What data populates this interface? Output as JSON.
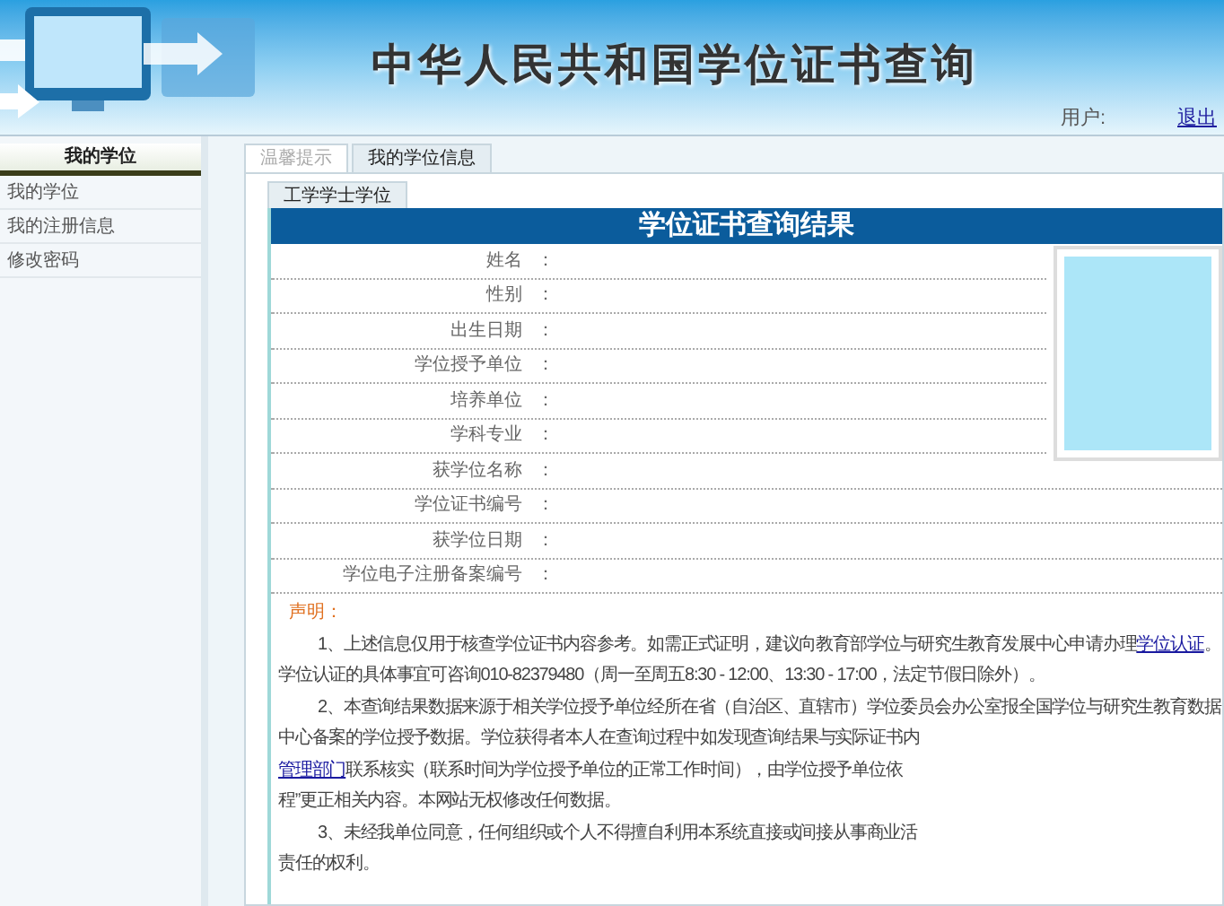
{
  "header": {
    "title": "中华人民共和国学位证书查询",
    "user_label": "用户:",
    "logout": "退出"
  },
  "sidebar": {
    "title": "我的学位",
    "items": [
      {
        "label": "我的学位"
      },
      {
        "label": "我的注册信息"
      },
      {
        "label": "修改密码"
      }
    ]
  },
  "tabs": [
    {
      "label": "温馨提示",
      "selected": false
    },
    {
      "label": "我的学位信息",
      "selected": true
    }
  ],
  "subtabs": [
    {
      "label": "工学学士学位",
      "selected": true
    }
  ],
  "result": {
    "title": "学位证书查询结果",
    "fields": [
      {
        "label": "姓名"
      },
      {
        "label": "性别"
      },
      {
        "label": "出生日期"
      },
      {
        "label": "学位授予单位"
      },
      {
        "label": "培养单位"
      },
      {
        "label": "学科专业"
      },
      {
        "label": "获学位名称"
      },
      {
        "label": "学位证书编号"
      },
      {
        "label": "获学位日期"
      },
      {
        "label": "学位电子注册备案编号"
      }
    ],
    "colon": "："
  },
  "notice": {
    "title": "声明：",
    "paragraphs": [
      {
        "lines": [
          [
            {
              "text": "1、上述信息仅用于核查学位证书内容参考。如需正式证明，建议向教育部学位与研究生教育发展中心申请办理"
            },
            {
              "text": "学位认证",
              "link": true
            },
            {
              "text": "。"
            }
          ],
          [
            {
              "text": "学位认证的具体事宜可咨询010-82379480（周一至周五8:30 - 12:00、13:30 - 17:00，法定节假日除外）。"
            }
          ]
        ]
      },
      {
        "lines": [
          [
            {
              "text": "2、本查询结果数据来源于相关学位授予单位经所在省（自治区、直辖市）学位委员会办公室报全国学位与研究生教育数据"
            }
          ],
          [
            {
              "text": "中心备案的学位授予数据。学位获得者本人在查询过程中如发现查询结果与实际证书内"
            }
          ],
          [
            {
              "text": "管理部门",
              "link": true
            },
            {
              "text": "联系核实（联系时间为学位授予单位的正常工作时间），由学位授予单位依"
            }
          ],
          [
            {
              "text": "程”更正相关内容。本网站无权修改任何数据。"
            }
          ]
        ]
      },
      {
        "lines": [
          [
            {
              "text": "3、未经我单位同意，任何组织或个人不得擅自利用本系统直接或间接从事商业活"
            }
          ],
          [
            {
              "text": "责任的权利。"
            }
          ]
        ]
      }
    ]
  }
}
